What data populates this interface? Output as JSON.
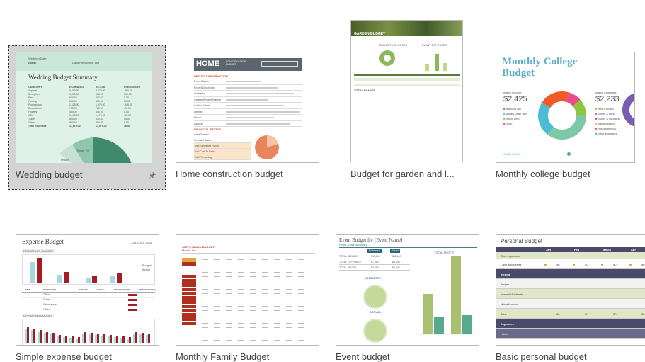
{
  "templates": [
    {
      "label": "Wedding budget",
      "selected": true,
      "pinned": true
    },
    {
      "label": "Home construction budget"
    },
    {
      "label": "Budget for garden and l..."
    },
    {
      "label": "Monthly college budget"
    },
    {
      "label": "Simple expense budget"
    },
    {
      "label": "Monthly Family Budget"
    },
    {
      "label": "Event budget"
    },
    {
      "label": "Basic personal budget"
    }
  ],
  "wedding_thumb": {
    "date_label": "Wedding Date:",
    "date_value": "[Date]",
    "days_remaining": "Days Remaining: 866",
    "title": "Wedding Budget Summary",
    "headers": [
      "CATEGORY",
      "ESTIMATED",
      "ACTUAL",
      "OVER/UNDER"
    ],
    "rows": [
      [
        "Apparel",
        "9,400.00",
        "9,770.00",
        "-380.00"
      ],
      [
        "Reception",
        "1,050.00",
        "950.00",
        "100.00"
      ],
      [
        "Rent",
        "600.00",
        "600.00",
        "0.00"
      ],
      [
        "Printing",
        "600.00",
        "550.00",
        "50.00"
      ],
      [
        "Photography",
        "1,625.00",
        "1,970.00",
        "-345.00"
      ],
      [
        "Decorations",
        "700.00",
        "720.00",
        "-20.00"
      ],
      [
        "Flowers",
        "450.00",
        "450.00",
        "0.00"
      ],
      [
        "Gifts",
        "1,165.00",
        "1,175.00",
        "-10.00"
      ],
      [
        "Travel",
        "855.00",
        "810.00",
        "45.00"
      ],
      [
        "Other",
        "880.00",
        "880.00",
        "0.00"
      ],
      [
        "Total Expenses",
        "17,610.00",
        "17,574.00",
        "36.00"
      ]
    ],
    "pie_labels": [
      "Travel 7%",
      "Gifts",
      "Phone",
      "Flowers"
    ]
  },
  "home_thumb": {
    "title": "HOME",
    "subtitle": "CONSTRUCTION BUDGET",
    "section1": "PROJECT INFORMATION",
    "fields": [
      "Project Name",
      "Project Description",
      "Contractor",
      "Contract/Project Number",
      "Contact Name",
      "Website",
      "Phone",
      "Address"
    ],
    "section2": "FINANCIAL STATUS",
    "fin_rows": [
      "Cash Started",
      "Financial Status",
      "Total Submitted Funds",
      "Total Cost To Date",
      "Total Remaining"
    ]
  },
  "garden_thumb": {
    "title": "GARDEN BUDGET",
    "cols": [
      "BUDGET VS. COSTS",
      "PLANT EXPENSES"
    ],
    "total_label": "TOTAL PLANTS"
  },
  "college_thumb": {
    "title": "Monthly College Budget",
    "income_label": "march income:",
    "income_value": "$2,425",
    "expenses_label": "march expenses:",
    "expenses_value": "$2,233",
    "income_items": [
      "financial aid",
      "wages (after tax)",
      "family help",
      "other"
    ],
    "expense_items": [
      "rent & board",
      "tuition & fees",
      "books & supplies",
      "transportation",
      "miscellaneous",
      "other expenses"
    ],
    "cashflow_label": "CASH FLOW"
  },
  "expense_thumb": {
    "title": "Expense Budget",
    "company": "CONTOSO, 2013",
    "section1": "PERSONNEL BUDGET",
    "section2": "OPERATING BUDGET",
    "headers": [
      "ITEM",
      "PERSONNEL",
      "BUDGET",
      "ACTUAL",
      "DIFFERENCE($)",
      "DIFFERENCE(%)"
    ],
    "items": [
      "Office",
      "Driver",
      "Salesperson",
      "Other"
    ],
    "legend": [
      "Budget",
      "Actual"
    ]
  },
  "family_thumb": {
    "title": "SMITH FAMILY BUDGET",
    "sub": "Month: Jan"
  },
  "event_thumb": {
    "title": "Event Budget for [Event Name]",
    "sub": "Profit - Loss Summary",
    "cols": [
      "Estimated",
      "Actual"
    ],
    "rows": [
      "TOTAL INCOME",
      "TOTAL EXPENSES",
      "TOTAL PROFIT"
    ],
    "vals": [
      [
        "$10,400",
        "$11,540"
      ],
      [
        "$7,950",
        "$6,035"
      ],
      [
        "$2,450",
        "$5,505"
      ]
    ],
    "estimated_label": "ESTIMATED",
    "actual_label": "ACTUAL",
    "total_profit_label": "TOTAL PROFIT"
  },
  "personal_thumb": {
    "title": "Personal Budget",
    "months": [
      "Jan",
      "Feb",
      "March",
      "Apr"
    ],
    "rows": [
      "Total expenses",
      "Cash short/extra",
      "Income",
      "Wages",
      "Interest/dividends",
      "Miscellaneous",
      "Total",
      "Expenses",
      "Home"
    ],
    "zero": "$0"
  }
}
